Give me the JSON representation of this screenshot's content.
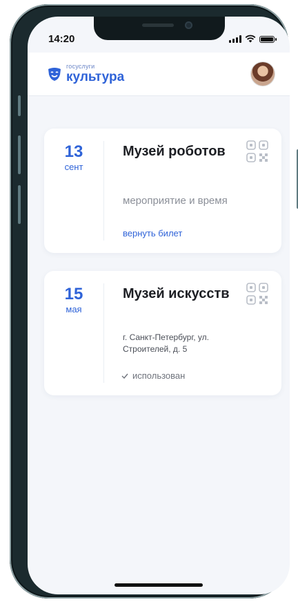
{
  "status_bar": {
    "time": "14:20"
  },
  "header": {
    "logo_small": "госуслуги",
    "logo_big": "культура"
  },
  "tickets": [
    {
      "day": "13",
      "month": "сент",
      "title": "Музей роботов",
      "subtitle": "мероприятие и время",
      "action": "вернуть билет"
    },
    {
      "day": "15",
      "month": "мая",
      "title": "Музей искусств",
      "address": "г. Санкт-Петербург, ул. Строителей, д. 5",
      "status": "использован"
    }
  ],
  "colors": {
    "accent": "#2f63d8",
    "background": "#f4f6fa",
    "card": "#ffffff"
  },
  "icons": [
    "signal-icon",
    "wifi-icon",
    "battery-icon",
    "logo-mask-icon",
    "avatar",
    "qr-code-icon",
    "check-icon"
  ]
}
